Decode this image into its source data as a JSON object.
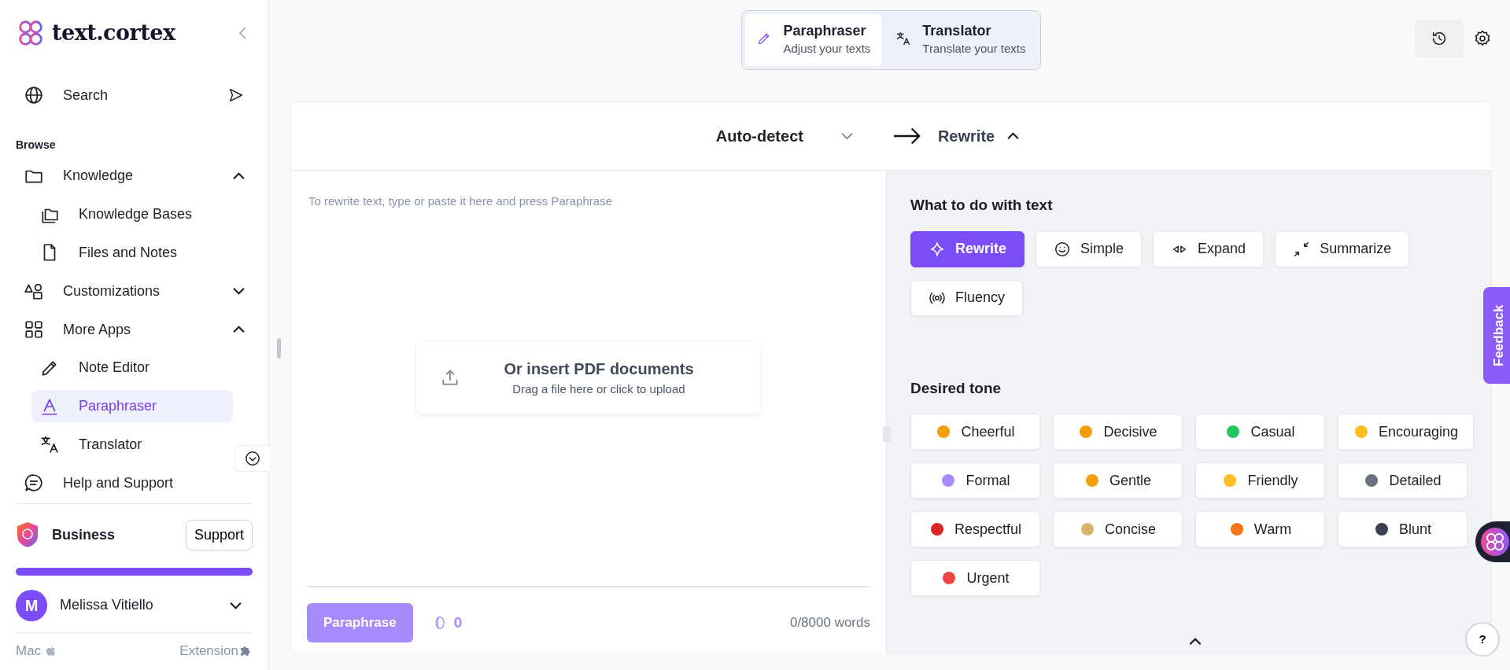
{
  "brand": {
    "name": "text.cortex"
  },
  "search": {
    "label": "Search"
  },
  "browse_heading": "Browse",
  "nav": [
    {
      "label": "Knowledge",
      "expanded": true,
      "children": [
        {
          "label": "Knowledge Bases",
          "selected": false
        },
        {
          "label": "Files and Notes",
          "selected": false
        }
      ]
    },
    {
      "label": "Customizations",
      "expanded": false
    },
    {
      "label": "More Apps",
      "expanded": true,
      "children": [
        {
          "label": "Note Editor",
          "selected": false
        },
        {
          "label": "Paraphraser",
          "selected": true
        },
        {
          "label": "Translator",
          "selected": false
        }
      ]
    },
    {
      "label": "Help and Support"
    }
  ],
  "plan": {
    "name": "Business",
    "support_button": "Support",
    "level": 1
  },
  "user": {
    "initial": "M",
    "name": "Melissa Vitiello"
  },
  "footer": {
    "left": "Mac",
    "right": "Extension"
  },
  "mode_tabs": [
    {
      "title": "Paraphraser",
      "subtitle": "Adjust your texts",
      "selected": true
    },
    {
      "title": "Translator",
      "subtitle": "Translate your texts",
      "selected": false
    }
  ],
  "language": {
    "source": "Auto-detect",
    "target": "Rewrite"
  },
  "editor": {
    "placeholder": "To rewrite text, type or paste it here and press Paraphrase",
    "upload_title": "Or insert PDF documents",
    "upload_hint": "Drag a file here or click to upload",
    "button": "Paraphrase",
    "credits": "0",
    "word_count": "0/8000 words"
  },
  "actions_heading": "What to do with text",
  "actions": [
    {
      "label": "Rewrite",
      "selected": true
    },
    {
      "label": "Simple",
      "selected": false
    },
    {
      "label": "Expand",
      "selected": false
    },
    {
      "label": "Summarize",
      "selected": false
    },
    {
      "label": "Fluency",
      "selected": false
    }
  ],
  "tone_heading": "Desired tone",
  "tones": [
    {
      "label": "Cheerful",
      "selected": false
    },
    {
      "label": "Decisive",
      "selected": false
    },
    {
      "label": "Casual",
      "selected": false
    },
    {
      "label": "Encouraging",
      "selected": false
    },
    {
      "label": "Formal",
      "selected": false
    },
    {
      "label": "Gentle",
      "selected": false
    },
    {
      "label": "Friendly",
      "selected": false
    },
    {
      "label": "Detailed",
      "selected": false
    },
    {
      "label": "Respectful",
      "selected": false
    },
    {
      "label": "Concise",
      "selected": false
    },
    {
      "label": "Warm",
      "selected": false
    },
    {
      "label": "Blunt",
      "selected": false
    },
    {
      "label": "Urgent",
      "selected": false
    }
  ],
  "feedback": "Feedback",
  "help_button": "?"
}
